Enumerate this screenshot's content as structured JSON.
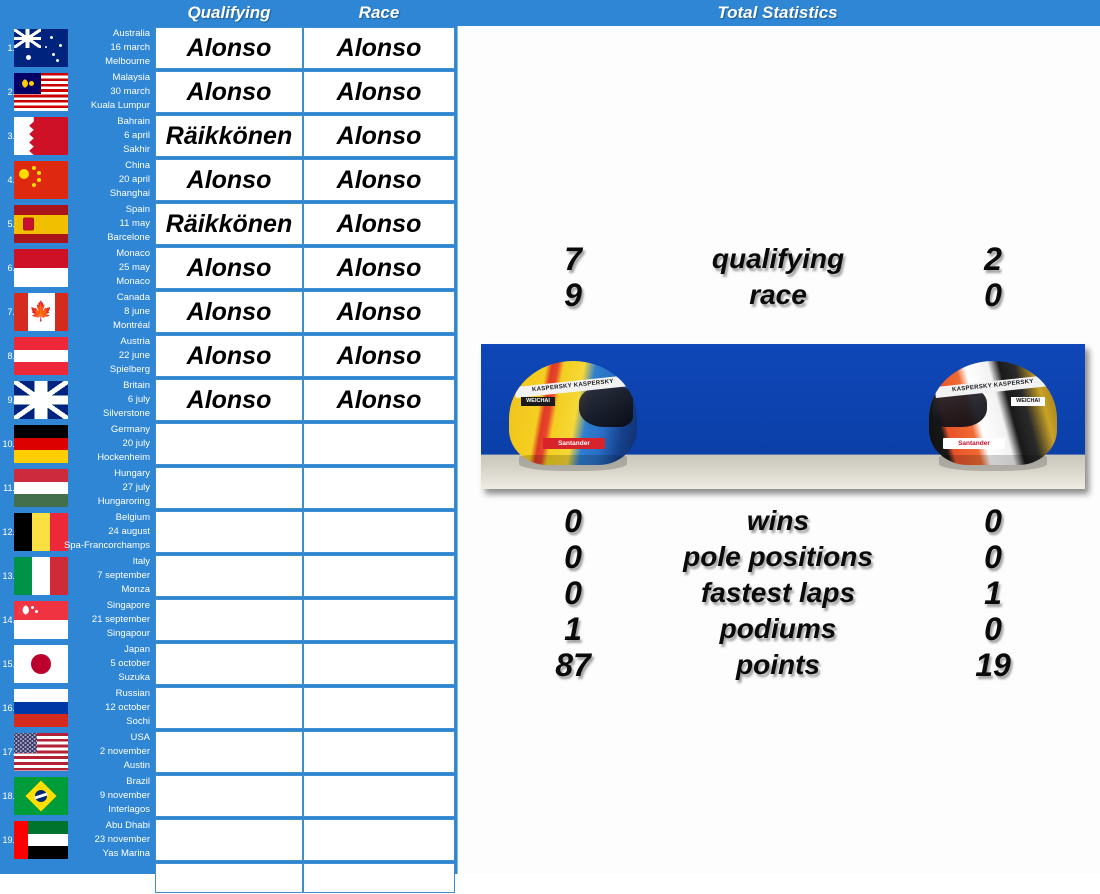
{
  "header": {
    "qualifying_label": "Qualifying",
    "race_label": "Race",
    "total_label": "Total Statistics"
  },
  "schedule": {
    "rows": [
      {
        "num": "1.",
        "flag": "au",
        "country": "Australia",
        "date": "16 march",
        "circuit": "Melbourne",
        "qualifying": "Alonso",
        "race": "Alonso"
      },
      {
        "num": "2.",
        "flag": "my",
        "country": "Malaysia",
        "date": "30 march",
        "circuit": "Kuala Lumpur",
        "qualifying": "Alonso",
        "race": "Alonso"
      },
      {
        "num": "3.",
        "flag": "bh",
        "country": "Bahrain",
        "date": "6 april",
        "circuit": "Sakhir",
        "qualifying": "Räikkönen",
        "race": "Alonso"
      },
      {
        "num": "4.",
        "flag": "cn",
        "country": "China",
        "date": "20 april",
        "circuit": "Shanghai",
        "qualifying": "Alonso",
        "race": "Alonso"
      },
      {
        "num": "5.",
        "flag": "es",
        "country": "Spain",
        "date": "11 may",
        "circuit": "Barcelone",
        "qualifying": "Räikkönen",
        "race": "Alonso"
      },
      {
        "num": "6.",
        "flag": "mc",
        "country": "Monaco",
        "date": "25 may",
        "circuit": "Monaco",
        "qualifying": "Alonso",
        "race": "Alonso"
      },
      {
        "num": "7.",
        "flag": "ca",
        "country": "Canada",
        "date": "8 june",
        "circuit": "Montréal",
        "qualifying": "Alonso",
        "race": "Alonso"
      },
      {
        "num": "8.",
        "flag": "at",
        "country": "Austria",
        "date": "22 june",
        "circuit": "Spielberg",
        "qualifying": "Alonso",
        "race": "Alonso"
      },
      {
        "num": "9.",
        "flag": "gb",
        "country": "Britain",
        "date": "6 july",
        "circuit": "Silverstone",
        "qualifying": "Alonso",
        "race": "Alonso"
      },
      {
        "num": "10.",
        "flag": "de",
        "country": "Germany",
        "date": "20 july",
        "circuit": "Hockenheim",
        "qualifying": "",
        "race": ""
      },
      {
        "num": "11.",
        "flag": "hu",
        "country": "Hungary",
        "date": "27 july",
        "circuit": "Hungaroring",
        "qualifying": "",
        "race": ""
      },
      {
        "num": "12.",
        "flag": "be",
        "country": "Belgium",
        "date": "24 august",
        "circuit": "Spa-Francorchamps",
        "qualifying": "",
        "race": ""
      },
      {
        "num": "13.",
        "flag": "it",
        "country": "Italy",
        "date": "7 september",
        "circuit": "Monza",
        "qualifying": "",
        "race": ""
      },
      {
        "num": "14.",
        "flag": "sg",
        "country": "Singapore",
        "date": "21 september",
        "circuit": "Singapour",
        "qualifying": "",
        "race": ""
      },
      {
        "num": "15.",
        "flag": "jp",
        "country": "Japan",
        "date": "5 october",
        "circuit": "Suzuka",
        "qualifying": "",
        "race": ""
      },
      {
        "num": "16.",
        "flag": "ru",
        "country": "Russian",
        "date": "12 october",
        "circuit": "Sochi",
        "qualifying": "",
        "race": ""
      },
      {
        "num": "17.",
        "flag": "us",
        "country": "USA",
        "date": "2 november",
        "circuit": "Austin",
        "qualifying": "",
        "race": ""
      },
      {
        "num": "18.",
        "flag": "br",
        "country": "Brazil",
        "date": "9 november",
        "circuit": "Interlagos",
        "qualifying": "",
        "race": ""
      },
      {
        "num": "19.",
        "flag": "ae",
        "country": "Abu Dhabi",
        "date": "23 november",
        "circuit": "Yas Marina",
        "qualifying": "",
        "race": ""
      },
      {
        "num": "",
        "flag": "",
        "country": "",
        "date": "",
        "circuit": "",
        "qualifying": "",
        "race": ""
      }
    ]
  },
  "statistics": {
    "head_to_head": [
      {
        "left": "7",
        "label": "qualifying",
        "right": "2"
      },
      {
        "left": "9",
        "label": "race",
        "right": "0"
      }
    ],
    "totals": [
      {
        "left": "0",
        "label": "wins",
        "right": "0"
      },
      {
        "left": "0",
        "label": "pole positions",
        "right": "0"
      },
      {
        "left": "0",
        "label": "fastest laps",
        "right": "1"
      },
      {
        "left": "1",
        "label": "podiums",
        "right": "0"
      },
      {
        "left": "87",
        "label": "points",
        "right": "19"
      }
    ]
  },
  "helmets": {
    "left_driver_sponsors": {
      "band": "KASPERSKY  KASPERSKY",
      "badge": "Santander",
      "badge2": "WEICHAI"
    },
    "right_driver_sponsors": {
      "band": "KASPERSKY  KASPERSKY",
      "badge": "Santander",
      "badge2": "WEICHAI"
    }
  },
  "colors": {
    "header_blue": "#2e86d4",
    "table_blue": "#2e86d4",
    "cell_border": "#3e8ecb",
    "panel_white": "#fdfdfd",
    "helmet_backdrop": "#0d47b5"
  }
}
